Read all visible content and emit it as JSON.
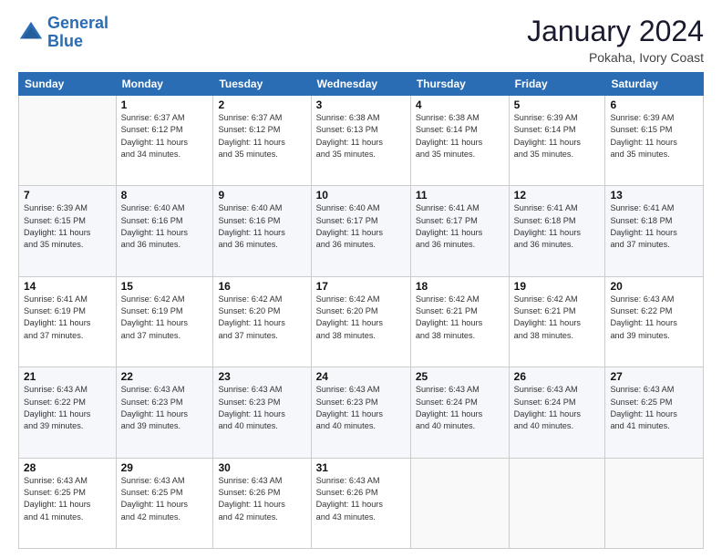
{
  "logo": {
    "line1": "General",
    "line2": "Blue"
  },
  "title": "January 2024",
  "location": "Pokaha, Ivory Coast",
  "days_header": [
    "Sunday",
    "Monday",
    "Tuesday",
    "Wednesday",
    "Thursday",
    "Friday",
    "Saturday"
  ],
  "weeks": [
    [
      {
        "day": "",
        "sunrise": "",
        "sunset": "",
        "daylight": ""
      },
      {
        "day": "1",
        "sunrise": "Sunrise: 6:37 AM",
        "sunset": "Sunset: 6:12 PM",
        "daylight": "Daylight: 11 hours and 34 minutes."
      },
      {
        "day": "2",
        "sunrise": "Sunrise: 6:37 AM",
        "sunset": "Sunset: 6:12 PM",
        "daylight": "Daylight: 11 hours and 35 minutes."
      },
      {
        "day": "3",
        "sunrise": "Sunrise: 6:38 AM",
        "sunset": "Sunset: 6:13 PM",
        "daylight": "Daylight: 11 hours and 35 minutes."
      },
      {
        "day": "4",
        "sunrise": "Sunrise: 6:38 AM",
        "sunset": "Sunset: 6:14 PM",
        "daylight": "Daylight: 11 hours and 35 minutes."
      },
      {
        "day": "5",
        "sunrise": "Sunrise: 6:39 AM",
        "sunset": "Sunset: 6:14 PM",
        "daylight": "Daylight: 11 hours and 35 minutes."
      },
      {
        "day": "6",
        "sunrise": "Sunrise: 6:39 AM",
        "sunset": "Sunset: 6:15 PM",
        "daylight": "Daylight: 11 hours and 35 minutes."
      }
    ],
    [
      {
        "day": "7",
        "sunrise": "Sunrise: 6:39 AM",
        "sunset": "Sunset: 6:15 PM",
        "daylight": "Daylight: 11 hours and 35 minutes."
      },
      {
        "day": "8",
        "sunrise": "Sunrise: 6:40 AM",
        "sunset": "Sunset: 6:16 PM",
        "daylight": "Daylight: 11 hours and 36 minutes."
      },
      {
        "day": "9",
        "sunrise": "Sunrise: 6:40 AM",
        "sunset": "Sunset: 6:16 PM",
        "daylight": "Daylight: 11 hours and 36 minutes."
      },
      {
        "day": "10",
        "sunrise": "Sunrise: 6:40 AM",
        "sunset": "Sunset: 6:17 PM",
        "daylight": "Daylight: 11 hours and 36 minutes."
      },
      {
        "day": "11",
        "sunrise": "Sunrise: 6:41 AM",
        "sunset": "Sunset: 6:17 PM",
        "daylight": "Daylight: 11 hours and 36 minutes."
      },
      {
        "day": "12",
        "sunrise": "Sunrise: 6:41 AM",
        "sunset": "Sunset: 6:18 PM",
        "daylight": "Daylight: 11 hours and 36 minutes."
      },
      {
        "day": "13",
        "sunrise": "Sunrise: 6:41 AM",
        "sunset": "Sunset: 6:18 PM",
        "daylight": "Daylight: 11 hours and 37 minutes."
      }
    ],
    [
      {
        "day": "14",
        "sunrise": "Sunrise: 6:41 AM",
        "sunset": "Sunset: 6:19 PM",
        "daylight": "Daylight: 11 hours and 37 minutes."
      },
      {
        "day": "15",
        "sunrise": "Sunrise: 6:42 AM",
        "sunset": "Sunset: 6:19 PM",
        "daylight": "Daylight: 11 hours and 37 minutes."
      },
      {
        "day": "16",
        "sunrise": "Sunrise: 6:42 AM",
        "sunset": "Sunset: 6:20 PM",
        "daylight": "Daylight: 11 hours and 37 minutes."
      },
      {
        "day": "17",
        "sunrise": "Sunrise: 6:42 AM",
        "sunset": "Sunset: 6:20 PM",
        "daylight": "Daylight: 11 hours and 38 minutes."
      },
      {
        "day": "18",
        "sunrise": "Sunrise: 6:42 AM",
        "sunset": "Sunset: 6:21 PM",
        "daylight": "Daylight: 11 hours and 38 minutes."
      },
      {
        "day": "19",
        "sunrise": "Sunrise: 6:42 AM",
        "sunset": "Sunset: 6:21 PM",
        "daylight": "Daylight: 11 hours and 38 minutes."
      },
      {
        "day": "20",
        "sunrise": "Sunrise: 6:43 AM",
        "sunset": "Sunset: 6:22 PM",
        "daylight": "Daylight: 11 hours and 39 minutes."
      }
    ],
    [
      {
        "day": "21",
        "sunrise": "Sunrise: 6:43 AM",
        "sunset": "Sunset: 6:22 PM",
        "daylight": "Daylight: 11 hours and 39 minutes."
      },
      {
        "day": "22",
        "sunrise": "Sunrise: 6:43 AM",
        "sunset": "Sunset: 6:23 PM",
        "daylight": "Daylight: 11 hours and 39 minutes."
      },
      {
        "day": "23",
        "sunrise": "Sunrise: 6:43 AM",
        "sunset": "Sunset: 6:23 PM",
        "daylight": "Daylight: 11 hours and 40 minutes."
      },
      {
        "day": "24",
        "sunrise": "Sunrise: 6:43 AM",
        "sunset": "Sunset: 6:23 PM",
        "daylight": "Daylight: 11 hours and 40 minutes."
      },
      {
        "day": "25",
        "sunrise": "Sunrise: 6:43 AM",
        "sunset": "Sunset: 6:24 PM",
        "daylight": "Daylight: 11 hours and 40 minutes."
      },
      {
        "day": "26",
        "sunrise": "Sunrise: 6:43 AM",
        "sunset": "Sunset: 6:24 PM",
        "daylight": "Daylight: 11 hours and 40 minutes."
      },
      {
        "day": "27",
        "sunrise": "Sunrise: 6:43 AM",
        "sunset": "Sunset: 6:25 PM",
        "daylight": "Daylight: 11 hours and 41 minutes."
      }
    ],
    [
      {
        "day": "28",
        "sunrise": "Sunrise: 6:43 AM",
        "sunset": "Sunset: 6:25 PM",
        "daylight": "Daylight: 11 hours and 41 minutes."
      },
      {
        "day": "29",
        "sunrise": "Sunrise: 6:43 AM",
        "sunset": "Sunset: 6:25 PM",
        "daylight": "Daylight: 11 hours and 42 minutes."
      },
      {
        "day": "30",
        "sunrise": "Sunrise: 6:43 AM",
        "sunset": "Sunset: 6:26 PM",
        "daylight": "Daylight: 11 hours and 42 minutes."
      },
      {
        "day": "31",
        "sunrise": "Sunrise: 6:43 AM",
        "sunset": "Sunset: 6:26 PM",
        "daylight": "Daylight: 11 hours and 43 minutes."
      },
      {
        "day": "",
        "sunrise": "",
        "sunset": "",
        "daylight": ""
      },
      {
        "day": "",
        "sunrise": "",
        "sunset": "",
        "daylight": ""
      },
      {
        "day": "",
        "sunrise": "",
        "sunset": "",
        "daylight": ""
      }
    ]
  ]
}
